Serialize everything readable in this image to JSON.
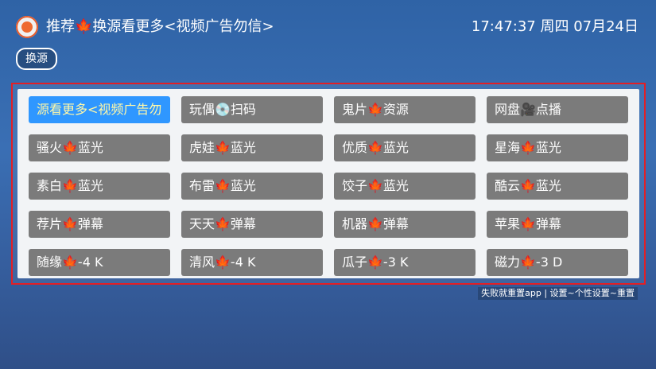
{
  "header": {
    "title": "推荐🍁换源看更多<视频广告勿信>",
    "clock": "17:47:37 周四 07月24日"
  },
  "toolbar": {
    "switch_source_label": "换源"
  },
  "grid": {
    "items": [
      {
        "label": "源看更多<视频广告勿"
      },
      {
        "label": "玩偶💿扫码"
      },
      {
        "label": "鬼片🍁资源"
      },
      {
        "label": "网盘🎥点播"
      },
      {
        "label": "骚火🍁蓝光"
      },
      {
        "label": "虎娃🍁蓝光"
      },
      {
        "label": "优质🍁蓝光"
      },
      {
        "label": "星海🍁蓝光"
      },
      {
        "label": "素白🍁蓝光"
      },
      {
        "label": "布雷🍁蓝光"
      },
      {
        "label": "饺子🍁蓝光"
      },
      {
        "label": "酷云🍁蓝光"
      },
      {
        "label": "荐片🍁弹幕"
      },
      {
        "label": "天天🍁弹幕"
      },
      {
        "label": "机器🍁弹幕"
      },
      {
        "label": "苹果🍁弹幕"
      },
      {
        "label": "随缘🍁-4 K"
      },
      {
        "label": "清风🍁-4 K"
      },
      {
        "label": "瓜子🍁-3 K"
      },
      {
        "label": "磁力🍁-3 D"
      }
    ]
  },
  "footer": {
    "note": "失败就重置app | 设置~个性设置~重置"
  },
  "colors": {
    "accent_selected": "#2f97ff",
    "cell_bg": "#7b7b7b",
    "panel_border": "#e21f26"
  }
}
